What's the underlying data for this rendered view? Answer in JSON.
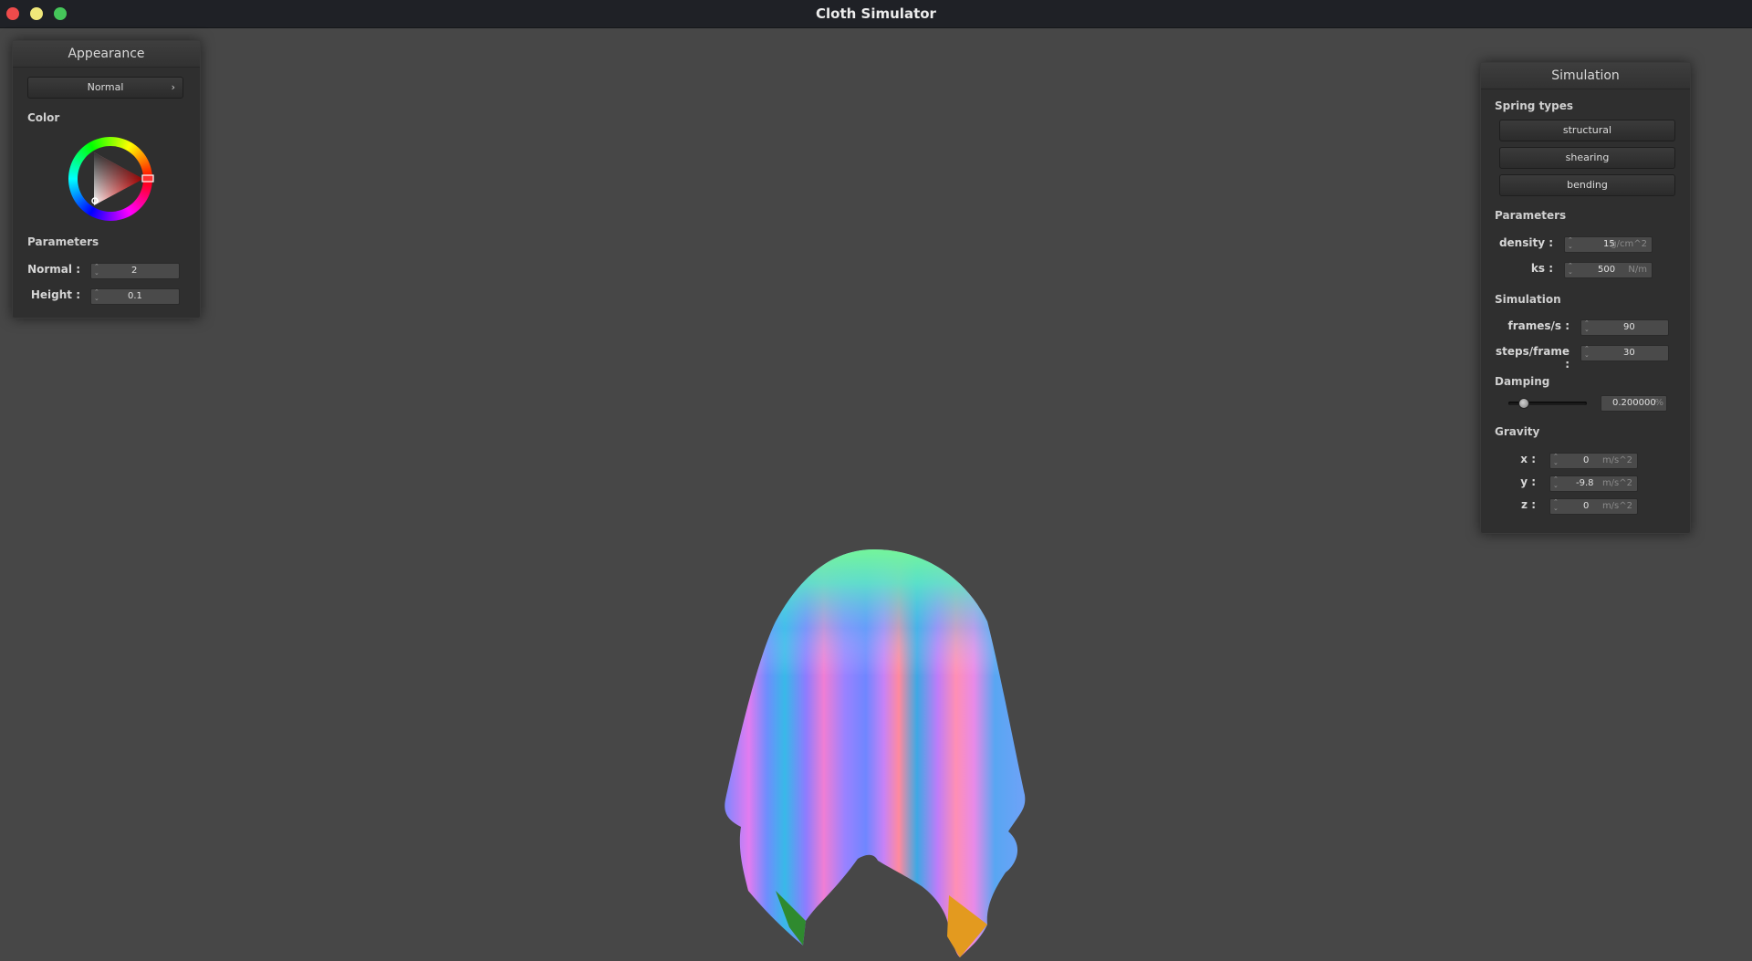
{
  "window": {
    "title": "Cloth Simulator"
  },
  "appearance": {
    "title": "Appearance",
    "shader": "Normal",
    "color_label": "Color",
    "parameters_label": "Parameters",
    "normal_label": "Normal :",
    "normal_value": "2",
    "height_label": "Height :",
    "height_value": "0.1",
    "selected_color": "#ff0000"
  },
  "simulation": {
    "title": "Simulation",
    "spring_types_label": "Spring types",
    "spring_buttons": [
      "structural",
      "shearing",
      "bending"
    ],
    "parameters_label": "Parameters",
    "density_label": "density :",
    "density_value": "15",
    "density_unit": "g/cm^2",
    "ks_label": "ks :",
    "ks_value": "500",
    "ks_unit": "N/m",
    "simulation_label": "Simulation",
    "fps_label": "frames/s :",
    "fps_value": "90",
    "steps_label": "steps/frame :",
    "steps_value": "30",
    "damping_label": "Damping",
    "damping_value": "0.200000",
    "damping_unit": "%",
    "damping_fraction": 0.2,
    "gravity_label": "Gravity",
    "gx_label": "x :",
    "gx_value": "0",
    "gy_label": "y :",
    "gy_value": "-9.8",
    "gz_label": "z :",
    "gz_value": "0",
    "gravity_unit": "m/s^2"
  }
}
